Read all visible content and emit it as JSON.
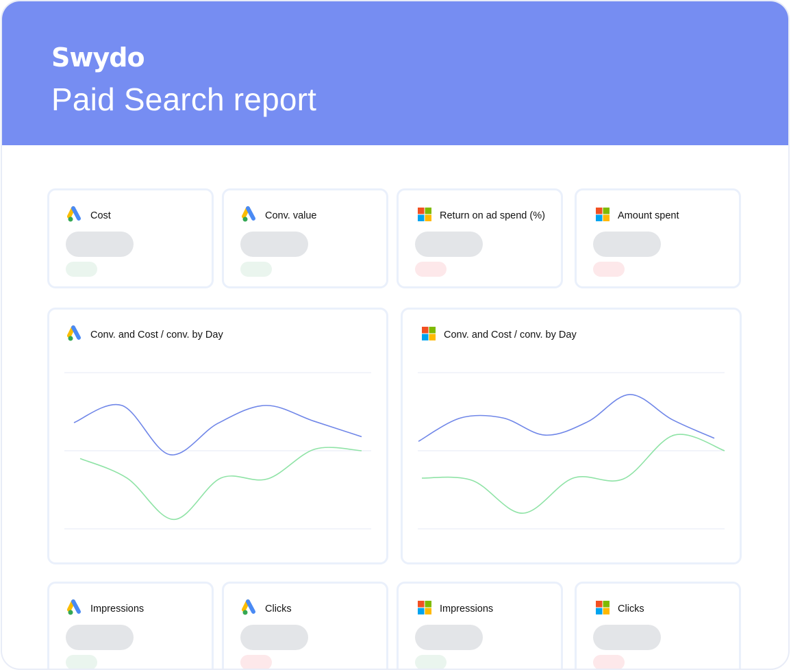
{
  "header": {
    "logo_text": "Swydo",
    "title": "Paid Search report",
    "background": "#768df2"
  },
  "kpi_top": [
    {
      "label": "Cost",
      "icon": "google-ads-icon",
      "trend": "green"
    },
    {
      "label": "Conv. value",
      "icon": "google-ads-icon",
      "trend": "green"
    },
    {
      "label": "Return on ad spend (%)",
      "icon": "microsoft-ads-icon",
      "trend": "red"
    },
    {
      "label": "Amount spent",
      "icon": "microsoft-ads-icon",
      "trend": "red"
    }
  ],
  "charts": [
    {
      "title": "Conv. and Cost / conv. by Day",
      "icon": "google-ads-icon"
    },
    {
      "title": "Conv. and Cost / conv. by Day",
      "icon": "microsoft-ads-icon"
    }
  ],
  "chart_data": [
    {
      "type": "line",
      "title": "Conv. and Cost / conv. by Day",
      "series": [
        {
          "color": "#6f86e8",
          "values": [
            0.36,
            0.58,
            -0.05,
            0.35,
            0.58,
            0.38,
            0.18
          ]
        },
        {
          "color": "#8fe3a6",
          "values": [
            -0.1,
            -0.35,
            -0.88,
            -0.35,
            -0.36,
            0.02,
            0.0
          ]
        }
      ],
      "ylim": [
        -1,
        1
      ],
      "grid": true
    },
    {
      "type": "line",
      "title": "Conv. and Cost / conv. by Day",
      "series": [
        {
          "color": "#6f86e8",
          "values": [
            0.12,
            0.42,
            0.42,
            0.2,
            0.37,
            0.72,
            0.4,
            0.16
          ]
        },
        {
          "color": "#8fe3a6",
          "values": [
            -0.35,
            -0.38,
            -0.8,
            -0.35,
            -0.36,
            0.2,
            0.0
          ]
        }
      ],
      "ylim": [
        -1,
        1
      ],
      "grid": true
    }
  ],
  "kpi_bottom": [
    {
      "label": "Impressions",
      "icon": "google-ads-icon",
      "trend": "green"
    },
    {
      "label": "Clicks",
      "icon": "google-ads-icon",
      "trend": "red"
    },
    {
      "label": "Impressions",
      "icon": "microsoft-ads-icon",
      "trend": "green"
    },
    {
      "label": "Clicks",
      "icon": "microsoft-ads-icon",
      "trend": "red"
    }
  ],
  "colors": {
    "google_blue": "#4a8af4",
    "google_yellow": "#fbbc04",
    "google_green": "#34a853",
    "ms_red": "#f25022",
    "ms_green": "#7fba00",
    "ms_blue": "#00a4ef",
    "ms_yellow": "#ffb900",
    "cost_line": "#6f86e8",
    "conv_line": "#8fe3a6"
  }
}
